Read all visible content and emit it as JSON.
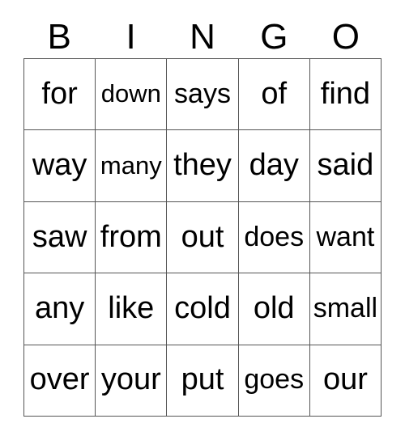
{
  "card": {
    "title": "BINGO",
    "columns": [
      "B",
      "I",
      "N",
      "G",
      "O"
    ],
    "grid_line_color": "#555555",
    "text_color": "#000000",
    "background_color": "#ffffff",
    "rows": [
      {
        "cells": [
          {
            "text": "for",
            "fit": ""
          },
          {
            "text": "down",
            "fit": "fit-sm"
          },
          {
            "text": "says",
            "fit": "fit-md"
          },
          {
            "text": "of",
            "fit": ""
          },
          {
            "text": "find",
            "fit": ""
          }
        ]
      },
      {
        "cells": [
          {
            "text": "way",
            "fit": ""
          },
          {
            "text": "many",
            "fit": "fit-sm"
          },
          {
            "text": "they",
            "fit": ""
          },
          {
            "text": "day",
            "fit": ""
          },
          {
            "text": "said",
            "fit": ""
          }
        ]
      },
      {
        "cells": [
          {
            "text": "saw",
            "fit": ""
          },
          {
            "text": "from",
            "fit": ""
          },
          {
            "text": "out",
            "fit": ""
          },
          {
            "text": "does",
            "fit": "fit-md"
          },
          {
            "text": "want",
            "fit": "fit-md"
          }
        ]
      },
      {
        "cells": [
          {
            "text": "any",
            "fit": ""
          },
          {
            "text": "like",
            "fit": ""
          },
          {
            "text": "cold",
            "fit": ""
          },
          {
            "text": "old",
            "fit": ""
          },
          {
            "text": "small",
            "fit": "fit-md"
          }
        ]
      },
      {
        "cells": [
          {
            "text": "over",
            "fit": ""
          },
          {
            "text": "your",
            "fit": ""
          },
          {
            "text": "put",
            "fit": ""
          },
          {
            "text": "goes",
            "fit": "fit-md"
          },
          {
            "text": "our",
            "fit": ""
          }
        ]
      }
    ]
  }
}
